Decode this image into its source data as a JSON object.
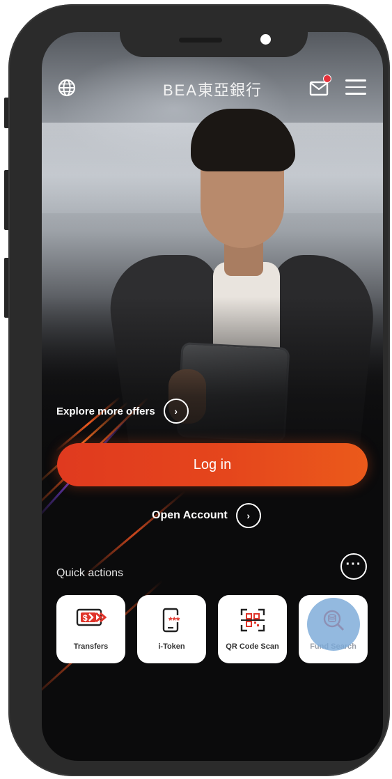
{
  "header": {
    "brand_en": "BEA",
    "brand_zh": "東亞銀行"
  },
  "hero": {
    "explore_label": "Explore more offers"
  },
  "actions": {
    "login_label": "Log in",
    "open_account_label": "Open Account"
  },
  "quick_actions": {
    "title": "Quick actions",
    "items": [
      {
        "label": "Transfers",
        "icon": "transfer-icon"
      },
      {
        "label": "i-Token",
        "icon": "phone-token-icon"
      },
      {
        "label": "QR Code Scan",
        "icon": "qr-scan-icon"
      },
      {
        "label": "Fund Search",
        "icon": "fund-search-icon"
      }
    ]
  },
  "colors": {
    "accent": "#e5461c",
    "icon_red": "#e0342a",
    "notification": "#e5313a",
    "background": "#0b0b0c"
  }
}
